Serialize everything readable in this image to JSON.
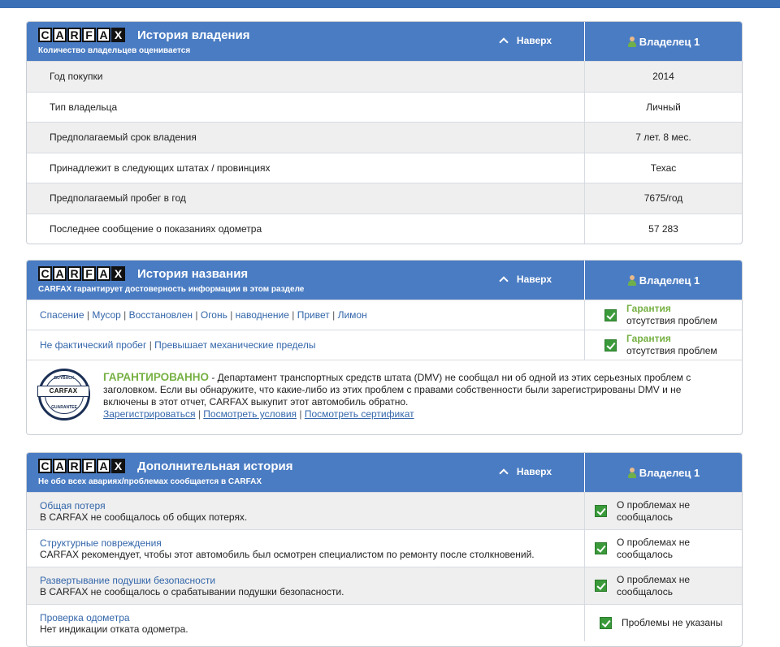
{
  "brand": {
    "logo_letters": [
      "C",
      "A",
      "R",
      "F",
      "A",
      "X"
    ],
    "colors": {
      "header": "#4a7cc3",
      "link": "#3366aa",
      "guarantee": "#76b043",
      "check": "#3a9a3a"
    }
  },
  "ownership": {
    "title": "История владения",
    "subtitle": "Количество владельцев оценивается",
    "top_link": "Наверх",
    "owner_label": "Владелец 1",
    "rows": [
      {
        "label": "Год покупки",
        "value": "2014"
      },
      {
        "label": "Тип владельца",
        "value": "Личный"
      },
      {
        "label": "Предполагаемый срок владения",
        "value": "7 лет. 8 мес."
      },
      {
        "label": "Принадлежит в следующих штатах / провинциях",
        "value": "Техас"
      },
      {
        "label": "Предполагаемый пробег в год",
        "value": "7675/год"
      },
      {
        "label": "Последнее сообщение о показаниях одометра",
        "value": "57 283"
      }
    ]
  },
  "title_history": {
    "title": "История названия",
    "subtitle": "CARFAX гарантирует достоверность информации в этом разделе",
    "top_link": "Наверх",
    "owner_label": "Владелец 1",
    "rows": [
      {
        "links": [
          "Спасение",
          "Мусор",
          "Восстановлен",
          "Огонь",
          "наводнение",
          "Привет",
          "Лимон"
        ],
        "status_head": "Гарантия",
        "status_sub": "отсутствия проблем"
      },
      {
        "links": [
          "Не фактический пробег",
          "Превышает механические пределы"
        ],
        "status_head": "Гарантия",
        "status_sub": "отсутствия проблем"
      }
    ],
    "guarantee": {
      "seal_top": "BUYBACK",
      "seal_bottom": "GUARANTEE",
      "headline": "ГАРАНТИРОВАННО",
      "text": " - Департамент транспортных средств штата (DMV) не сообщал ни об одной из этих серьезных проблем с заголовком. Если вы обнаружите, что какие-либо из этих проблем с правами собственности были зарегистрированы DMV и не включены в этот отчет, CARFAX выкупит этот автомобиль обратно.",
      "links": [
        "Зарегистрироваться",
        "Посмотреть условия",
        "Посмотреть сертификат"
      ]
    }
  },
  "additional": {
    "title": "Дополнительная история",
    "subtitle": "Не обо всех авариях/проблемах сообщается в CARFAX",
    "top_link": "Наверх",
    "owner_label": "Владелец 1",
    "rows": [
      {
        "title": "Общая потеря",
        "desc": "В CARFAX не сообщалось об общих потерях.",
        "status_l1": "О проблемах не",
        "status_l2": "сообщалось"
      },
      {
        "title": "Структурные повреждения",
        "desc": "CARFAX рекомендует, чтобы этот автомобиль был осмотрен специалистом по ремонту после столкновений.",
        "status_l1": "О проблемах не",
        "status_l2": "сообщалось"
      },
      {
        "title": "Развертывание подушки безопасности",
        "desc": "В CARFAX не сообщалось о срабатывании подушки безопасности.",
        "status_l1": "О проблемах не",
        "status_l2": "сообщалось"
      },
      {
        "title": "Проверка одометра",
        "desc": "Нет индикации отката одометра.",
        "status_l1": "Проблемы не указаны",
        "status_l2": ""
      }
    ]
  }
}
